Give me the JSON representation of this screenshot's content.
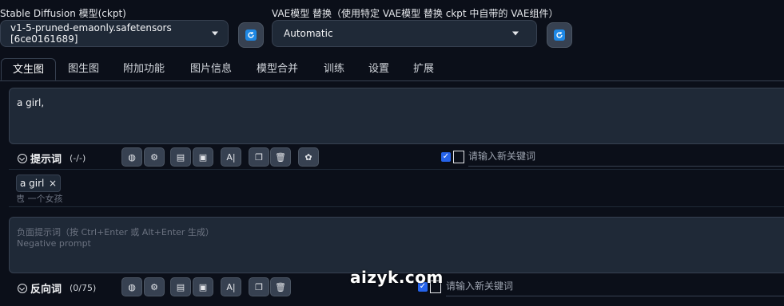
{
  "model": {
    "label": "Stable Diffusion 模型(ckpt)",
    "selected": "v1-5-pruned-emaonly.safetensors [6ce0161689]"
  },
  "vae": {
    "label": "VAE模型 替换（使用特定 VAE模型 替换 ckpt 中自带的 VAE组件）",
    "selected": "Automatic"
  },
  "tabs": [
    "文生图",
    "图生图",
    "附加功能",
    "图片信息",
    "模型合并",
    "训练",
    "设置",
    "扩展"
  ],
  "prompt": {
    "value": "a girl,",
    "title": "提示词",
    "count": "(-/-)",
    "keyword_placeholder": "请输入新关键词",
    "tag_text": "a girl",
    "tag_close": "×",
    "tag_translation_prefix": "㕀",
    "tag_translation": "一个女孩"
  },
  "negative": {
    "placeholder_line1": "负面提示词（按 Ctrl+Enter 或 Alt+Enter 生成）",
    "placeholder_line2": "Negative prompt",
    "title": "反向词",
    "count": "(0/75)",
    "keyword_placeholder": "请输入新关键词"
  },
  "toolbar_icons": [
    "globe-icon",
    "settings-icon",
    "history-icon",
    "bookmark-icon",
    "translate-icon",
    "copy-icon",
    "trash-icon",
    "openai-icon"
  ],
  "toolbar_glyphs": {
    "globe": "◍",
    "settings": "⚙",
    "history": "▤",
    "bookmark": "▣",
    "translate": "A|",
    "copy": "❐",
    "trash": "🗑",
    "openai": "✿"
  },
  "checkbox_mark": "✓",
  "watermark": "aizyk.com",
  "colors": {
    "accent": "#2563eb",
    "background": "#0b0f19",
    "panel": "#1f2937",
    "border": "#374151"
  }
}
